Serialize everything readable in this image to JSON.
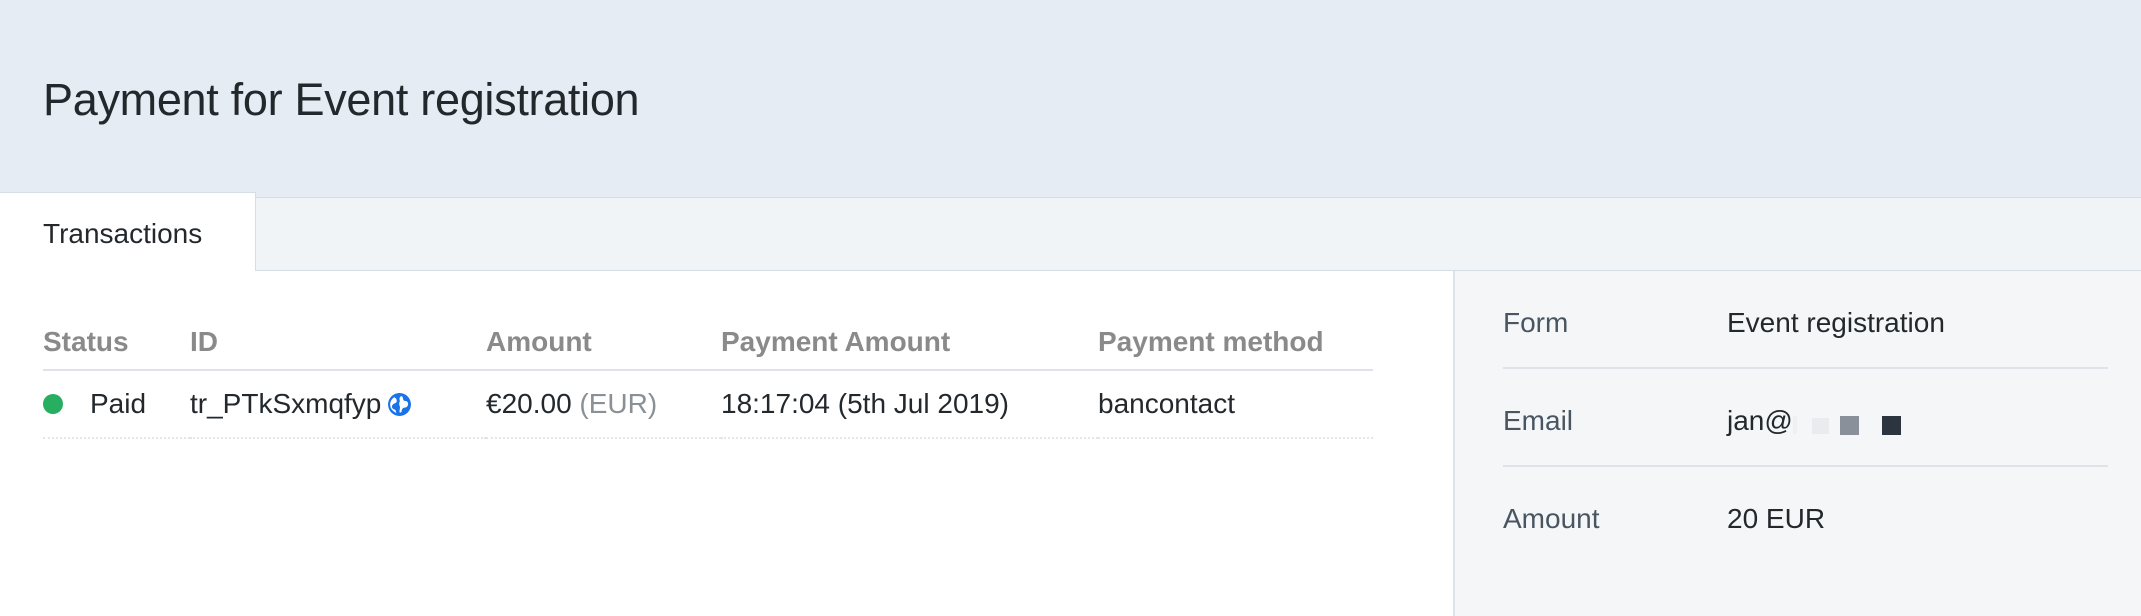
{
  "header": {
    "title": "Payment for Event registration"
  },
  "tabs": [
    {
      "label": "Transactions"
    }
  ],
  "transactions": {
    "columns": [
      "Status",
      "ID",
      "Amount",
      "Payment Amount",
      "Payment method"
    ],
    "rows": [
      {
        "status": "Paid",
        "status_color": "#27ae60",
        "id": "tr_PTkSxmqfyp",
        "id_icon": "globe-icon",
        "amount": "€20.00",
        "currency": "(EUR)",
        "payment_amount": "18:17:04 (5th Jul 2019)",
        "payment_method": "bancontact"
      }
    ]
  },
  "details": [
    {
      "label": "Form",
      "value": "Event registration"
    },
    {
      "label": "Email",
      "value": "jan@"
    },
    {
      "label": "Amount",
      "value": "20 EUR"
    }
  ],
  "colors": {
    "header_bg": "#e5ecf4",
    "tabbar_bg": "#f0f4f7",
    "sidebar_bg": "#f4f6f8",
    "status_paid": "#27ae60",
    "link_blue": "#1a73e8"
  }
}
